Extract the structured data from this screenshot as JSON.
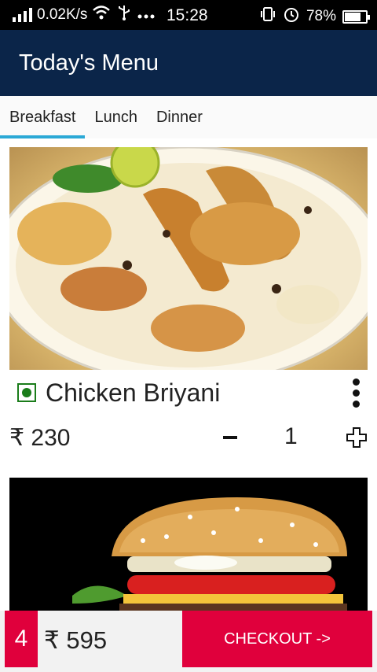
{
  "status_bar": {
    "speed": "0.02K/s",
    "time": "15:28",
    "battery": "78%",
    "battery_level": 0.78,
    "icons": [
      "signal-icon",
      "wifi-icon",
      "usb-icon",
      "more-dots-icon",
      "vibrate-icon",
      "alarm-icon",
      "battery-icon"
    ]
  },
  "app_bar": {
    "title": "Today's Menu"
  },
  "tabs": [
    {
      "label": "Breakfast",
      "active": true
    },
    {
      "label": "Lunch",
      "active": false
    },
    {
      "label": "Dinner",
      "active": false
    }
  ],
  "menu_items": [
    {
      "name": "Chicken Briyani",
      "price": "₹ 230",
      "quantity": "1"
    },
    {
      "name": "",
      "price": "",
      "quantity": ""
    }
  ],
  "cart": {
    "count": "4",
    "total": "₹ 595",
    "checkout_label": "CHECKOUT ->"
  },
  "colors": {
    "app_bar": "#0b2549",
    "accent_tab": "#2ba9d6",
    "checkout": "#e0003c",
    "veg": "#1a7c1a"
  }
}
